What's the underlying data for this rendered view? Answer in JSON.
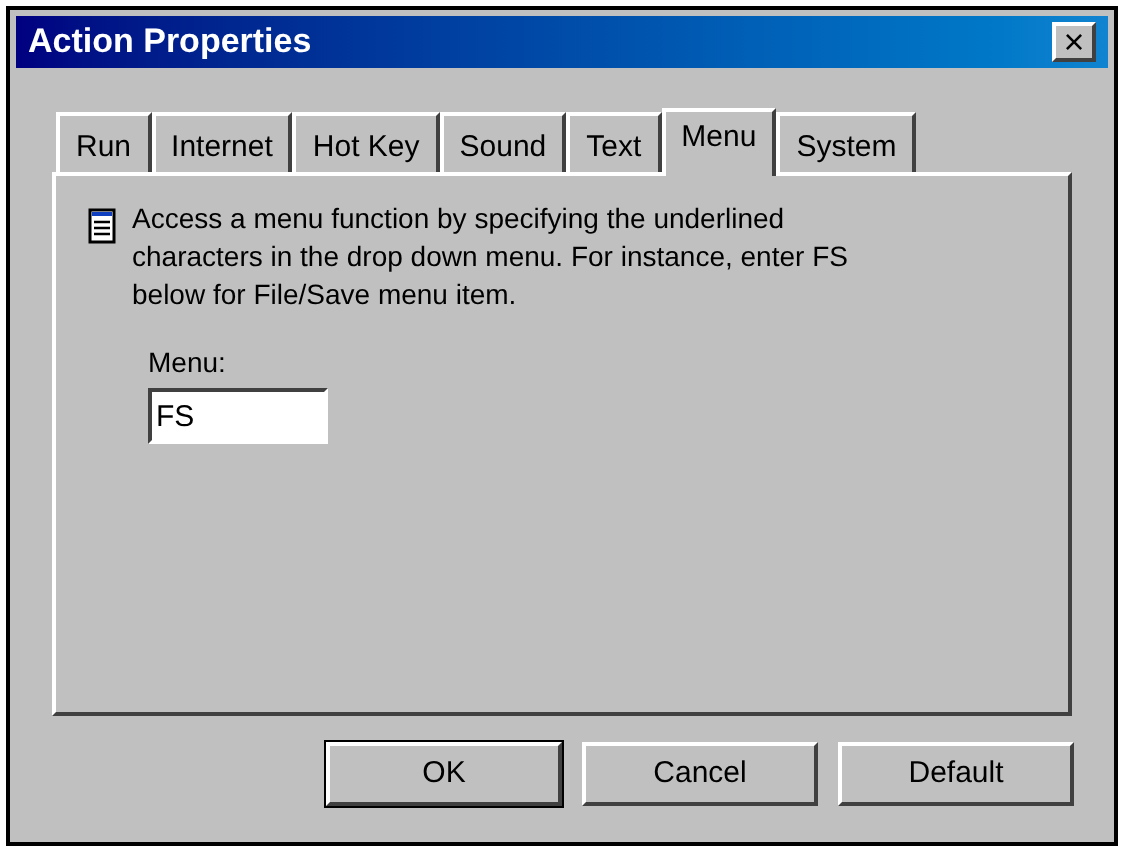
{
  "window": {
    "title": "Action Properties",
    "close": "×"
  },
  "tabs": [
    {
      "label": "Run",
      "selected": false
    },
    {
      "label": "Internet",
      "selected": false
    },
    {
      "label": "Hot Key",
      "selected": false
    },
    {
      "label": "Sound",
      "selected": false
    },
    {
      "label": "Text",
      "selected": false
    },
    {
      "label": "Menu",
      "selected": true
    },
    {
      "label": "System",
      "selected": false
    }
  ],
  "description": "Access a menu function by specifying the underlined characters in the drop down menu. For instance, enter FS below for File/Save menu item.",
  "field": {
    "label": "Menu:",
    "value": "FS"
  },
  "buttons": [
    {
      "label": "OK",
      "default": true
    },
    {
      "label": "Cancel",
      "default": false
    },
    {
      "label": "Default",
      "default": false
    }
  ]
}
